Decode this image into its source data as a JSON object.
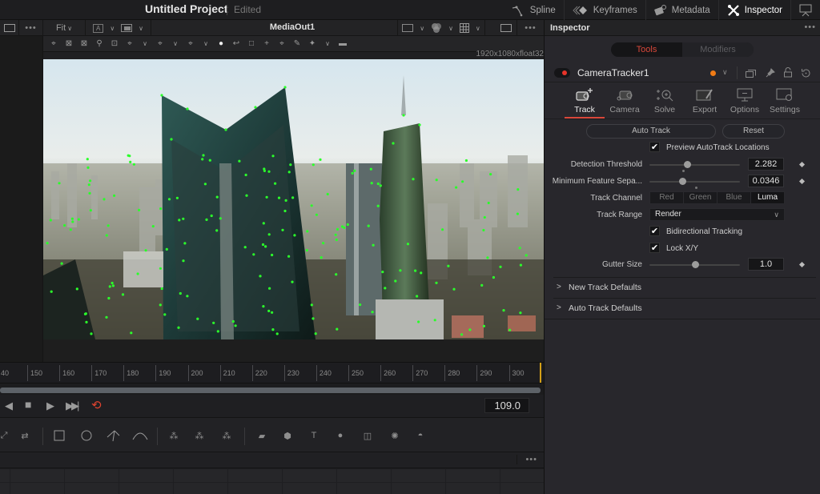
{
  "app": {
    "project_title": "Untitled Project",
    "status": "Edited"
  },
  "topnav": [
    {
      "label": "Spline",
      "icon": "spline-icon",
      "active": false
    },
    {
      "label": "Keyframes",
      "icon": "keyframes-icon",
      "active": false
    },
    {
      "label": "Metadata",
      "icon": "metadata-icon",
      "active": false
    },
    {
      "label": "Inspector",
      "icon": "inspector-icon",
      "active": true
    }
  ],
  "viewer": {
    "zoom": "Fit",
    "title": "MediaOut1",
    "resolution": "1920x1080xfloat32",
    "more": "•••"
  },
  "timeline": {
    "ticks": [
      "40",
      "150",
      "160",
      "170",
      "180",
      "190",
      "200",
      "210",
      "220",
      "230",
      "240",
      "250",
      "260",
      "270",
      "280",
      "290",
      "300"
    ],
    "current_frame": "109.0",
    "accent": "#d4a017"
  },
  "nodebar": {
    "more": "•••"
  },
  "inspector": {
    "title": "Inspector",
    "more": "•••",
    "segments": {
      "tools": "Tools",
      "modifiers": "Modifiers",
      "active": "Tools"
    },
    "node": {
      "name": "CameraTracker1",
      "color": "#f07b15",
      "enabled": true
    },
    "tabs": [
      {
        "label": "Track",
        "icon": "track-icon",
        "active": true
      },
      {
        "label": "Camera",
        "icon": "camera-icon",
        "active": false
      },
      {
        "label": "Solve",
        "icon": "solve-icon",
        "active": false
      },
      {
        "label": "Export",
        "icon": "export-icon",
        "active": false
      },
      {
        "label": "Options",
        "icon": "options-icon",
        "active": false
      },
      {
        "label": "Settings",
        "icon": "settings-icon",
        "active": false
      }
    ],
    "buttons": {
      "auto_track": "Auto Track",
      "reset": "Reset"
    },
    "preview_autotrack": {
      "label": "Preview AutoTrack Locations",
      "checked": true
    },
    "detection_threshold": {
      "label": "Detection Threshold",
      "value": "2.282",
      "slider_fraction": 0.42
    },
    "min_feature_sep": {
      "label": "Minimum Feature Sepa...",
      "value": "0.0346",
      "slider_fraction": 0.36
    },
    "track_channel": {
      "label": "Track Channel",
      "options": [
        "Red",
        "Green",
        "Blue",
        "Luma"
      ],
      "selected": "Luma"
    },
    "track_range": {
      "label": "Track Range",
      "value": "Render"
    },
    "bidirectional": {
      "label": "Bidirectional Tracking",
      "checked": true
    },
    "lock_xy": {
      "label": "Lock X/Y",
      "checked": true
    },
    "gutter_size": {
      "label": "Gutter Size",
      "value": "1.0",
      "slider_fraction": 0.5
    },
    "sections": [
      {
        "label": "New Track Defaults",
        "expanded": false
      },
      {
        "label": "Auto Track Defaults",
        "expanded": false
      }
    ],
    "accent": "#d9473a"
  }
}
